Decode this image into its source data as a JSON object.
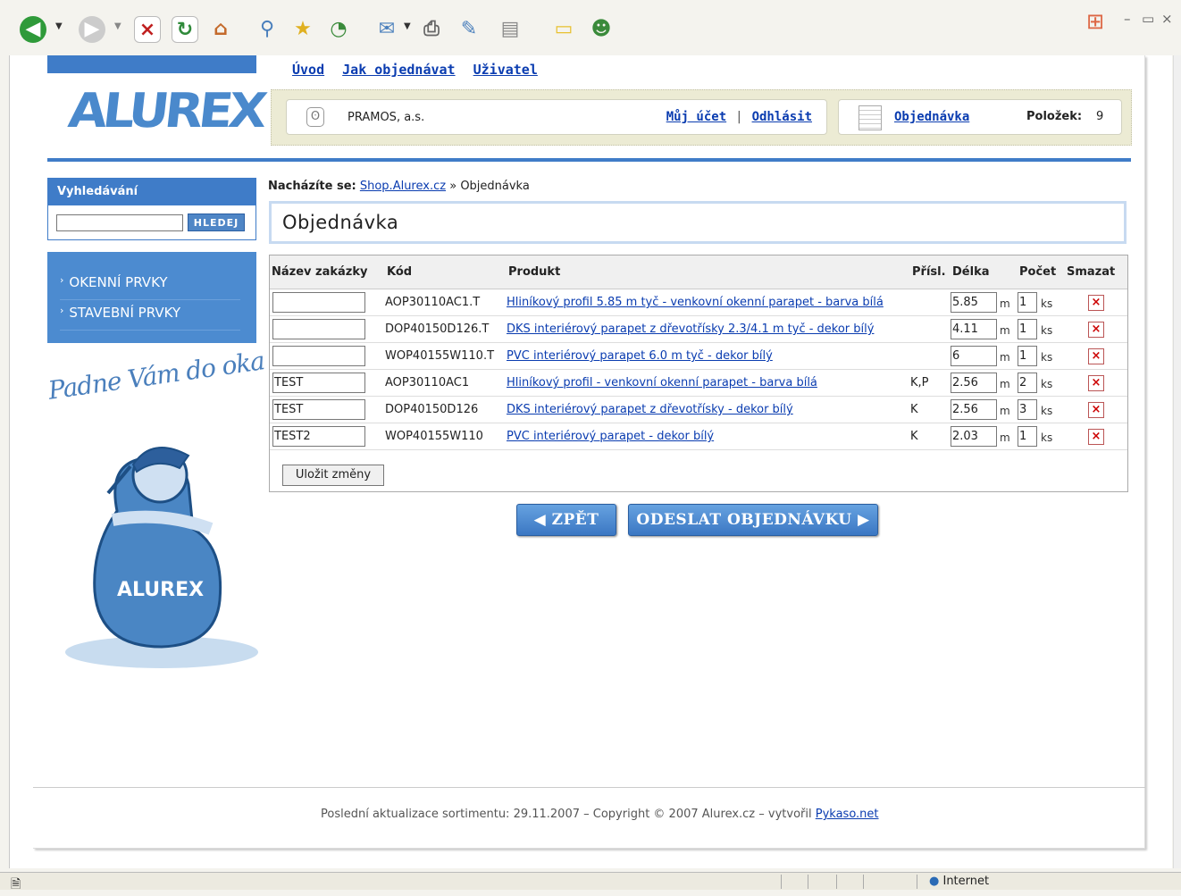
{
  "browser": {
    "toolbar_icons": [
      "back-icon",
      "forward-icon",
      "stop-icon",
      "refresh-icon",
      "home-icon",
      "search-icon",
      "favorites-icon",
      "history-icon",
      "mail-icon",
      "print-icon",
      "edit-icon",
      "discuss-icon",
      "folder-icon",
      "messenger-icon"
    ],
    "window_controls": [
      "minimize",
      "restore",
      "close"
    ],
    "status_zone": "Internet"
  },
  "top_nav": [
    "Úvod",
    "Jak objednávat",
    "Uživatel"
  ],
  "logo": {
    "text": "ALUREX",
    "mark": "®"
  },
  "user_bar": {
    "company": "PRAMOS, a.s.",
    "my_account": "Můj účet",
    "separator": "|",
    "logout": "Odhlásit",
    "order_link": "Objednávka",
    "items_label": "Položek:",
    "items_count": "9"
  },
  "sidebar": {
    "search_title": "Vyhledávání",
    "search_value": "",
    "search_button": "HLEDEJ",
    "menu": [
      "OKENNÍ PRVKY",
      "STAVEBNÍ PRVKY"
    ],
    "slogan": "Padne Vám do oka"
  },
  "breadcrumb": {
    "label": "Nacházíte se:",
    "link": "Shop.Alurex.cz",
    "sep": "»",
    "current": "Objednávka"
  },
  "page_title": "Objednávka",
  "table": {
    "headers": [
      "Název zakázky",
      "Kód",
      "Produkt",
      "Přísl.",
      "Délka",
      "Počet",
      "Smazat"
    ],
    "rows": [
      {
        "name": "",
        "code": "AOP30110AC1.T",
        "product": "Hliníkový profil 5.85 m tyč - venkovní okenní parapet - barva bílá",
        "acc": "",
        "length": "5.85",
        "unit_l": "m",
        "count": "1",
        "unit_c": "ks"
      },
      {
        "name": "",
        "code": "DOP40150D126.T",
        "product": "DKS interiérový parapet z dřevotřísky 2.3/4.1 m tyč - dekor bílý",
        "acc": "",
        "length": "4.11",
        "unit_l": "m",
        "count": "1",
        "unit_c": "ks"
      },
      {
        "name": "",
        "code": "WOP40155W110.T",
        "product": "PVC interiérový parapet 6.0 m tyč - dekor bílý",
        "acc": "",
        "length": "6",
        "unit_l": "m",
        "count": "1",
        "unit_c": "ks"
      },
      {
        "name": "TEST",
        "code": "AOP30110AC1",
        "product": "Hliníkový profil - venkovní okenní parapet - barva bílá",
        "acc": "K,P",
        "length": "2.56",
        "unit_l": "m",
        "count": "2",
        "unit_c": "ks"
      },
      {
        "name": "TEST",
        "code": "DOP40150D126",
        "product": "DKS interiérový parapet z dřevotřísky - dekor bílý",
        "acc": "K",
        "length": "2.56",
        "unit_l": "m",
        "count": "3",
        "unit_c": "ks"
      },
      {
        "name": "TEST2",
        "code": "WOP40155W110",
        "product": "PVC interiérový parapet - dekor bílý",
        "acc": "K",
        "length": "2.03",
        "unit_l": "m",
        "count": "1",
        "unit_c": "ks"
      }
    ],
    "save_button": "Uložit změny",
    "delete_icon": "×"
  },
  "buttons": {
    "back": "ZPĚT",
    "back_icon": "◀",
    "send": "ODESLAT OBJEDNÁVKU",
    "send_icon": "▶"
  },
  "footer": {
    "text": "Poslední aktualizace sortimentu: 29.11.2007 – Copyright © 2007 Alurex.cz – vytvořil",
    "link": "Pykaso.net"
  },
  "colors": {
    "brand_blue": "#3f7cc8",
    "link": "#0a3cb0",
    "delete_red": "#cc0000"
  }
}
